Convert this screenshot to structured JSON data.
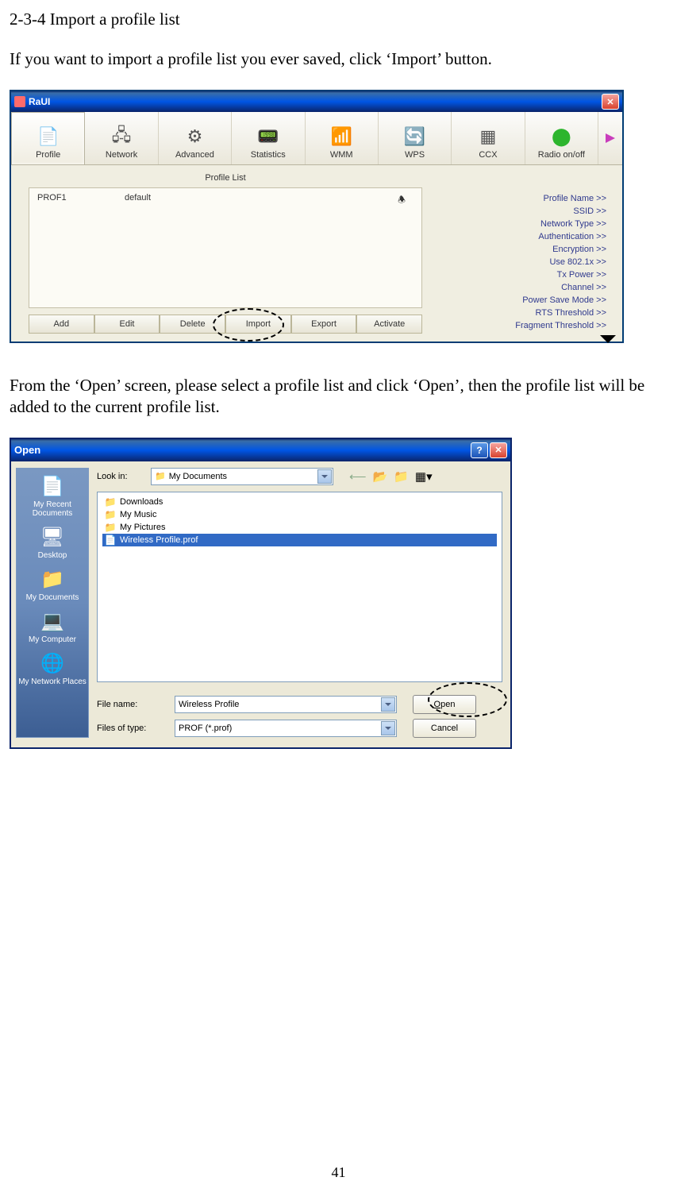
{
  "doc": {
    "heading": "2-3-4 Import a profile list",
    "para1": "If you want to import a profile list you ever saved, click ‘Import’ button.",
    "para2": "From the ‘Open’ screen, please select a profile list and click ‘Open’, then the profile list will be added to the current profile list.",
    "page_num": "41"
  },
  "raui": {
    "title": "RaUI",
    "toolbar": [
      "Profile",
      "Network",
      "Advanced",
      "Statistics",
      "WMM",
      "WPS",
      "CCX",
      "Radio on/off"
    ],
    "profile_list_label": "Profile List",
    "profile": {
      "name": "PROF1",
      "ssid": "default"
    },
    "actions": [
      "Add",
      "Edit",
      "Delete",
      "Import",
      "Export",
      "Activate"
    ],
    "details": [
      "Profile Name >>",
      "SSID >>",
      "Network Type >>",
      "Authentication >>",
      "Encryption >>",
      "Use 802.1x >>",
      "Tx Power >>",
      "Channel >>",
      "Power Save Mode >>",
      "RTS Threshold >>",
      "Fragment Threshold >>"
    ]
  },
  "open": {
    "title": "Open",
    "lookin_label": "Look in:",
    "lookin_value": "My Documents",
    "sidebar": [
      "My Recent Documents",
      "Desktop",
      "My Documents",
      "My Computer",
      "My Network Places"
    ],
    "files": [
      {
        "name": "Downloads",
        "type": "folder"
      },
      {
        "name": "My Music",
        "type": "folder"
      },
      {
        "name": "My Pictures",
        "type": "folder"
      },
      {
        "name": "Wireless Profile.prof",
        "type": "file",
        "selected": true
      }
    ],
    "filename_label": "File name:",
    "filename_value": "Wireless Profile",
    "filetype_label": "Files of type:",
    "filetype_value": "PROF (*.prof)",
    "open_btn": "Open",
    "cancel_btn": "Cancel"
  }
}
